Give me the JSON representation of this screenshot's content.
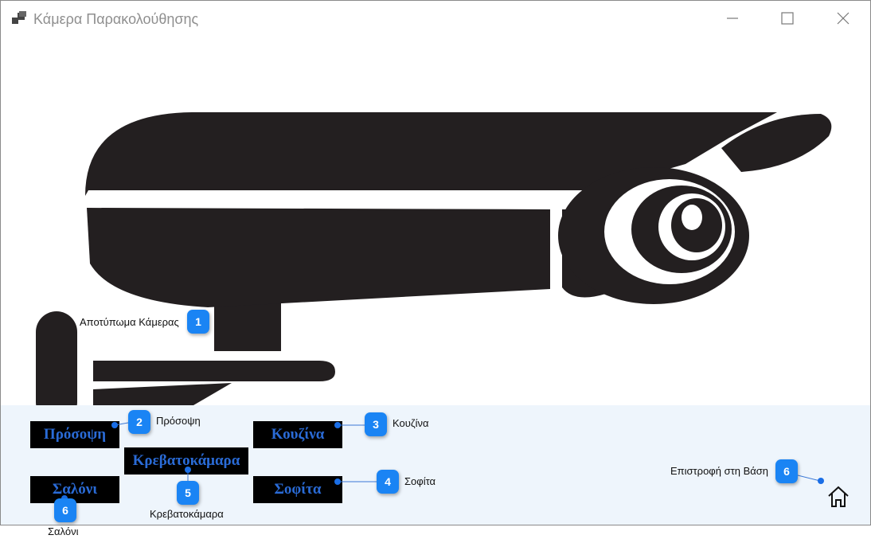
{
  "window": {
    "title": "Κάμερα Παρακολούθησης",
    "controls": {
      "minimize": "minimize-icon",
      "maximize": "maximize-icon",
      "close": "close-icon"
    }
  },
  "image": {
    "icon": "security-camera-icon",
    "color": "#231f20"
  },
  "buttons": {
    "front": "Πρόσοψη",
    "kitchen": "Κουζίνα",
    "bedroom": "Κρεβατοκάμαρα",
    "living": "Σαλόνι",
    "attic": "Σοφίτα",
    "home_icon": "home-icon"
  },
  "annotations": [
    {
      "number": "1",
      "label": "Αποτύπωμα Κάμερας"
    },
    {
      "number": "2",
      "label": "Πρόσοψη"
    },
    {
      "number": "3",
      "label": "Κουζίνα"
    },
    {
      "number": "4",
      "label": "Σοφίτα"
    },
    {
      "number": "5",
      "label": "Κρεβατοκάμαρα"
    },
    {
      "number": "6",
      "label": "Σαλόνι"
    },
    {
      "number": "6",
      "label": "Επιστροφή στη Βάση"
    }
  ],
  "colors": {
    "badge": "#1a84f4",
    "button_bg": "#000000",
    "button_text": "#2a6bd6",
    "panel_bg": "#eef5fc"
  }
}
